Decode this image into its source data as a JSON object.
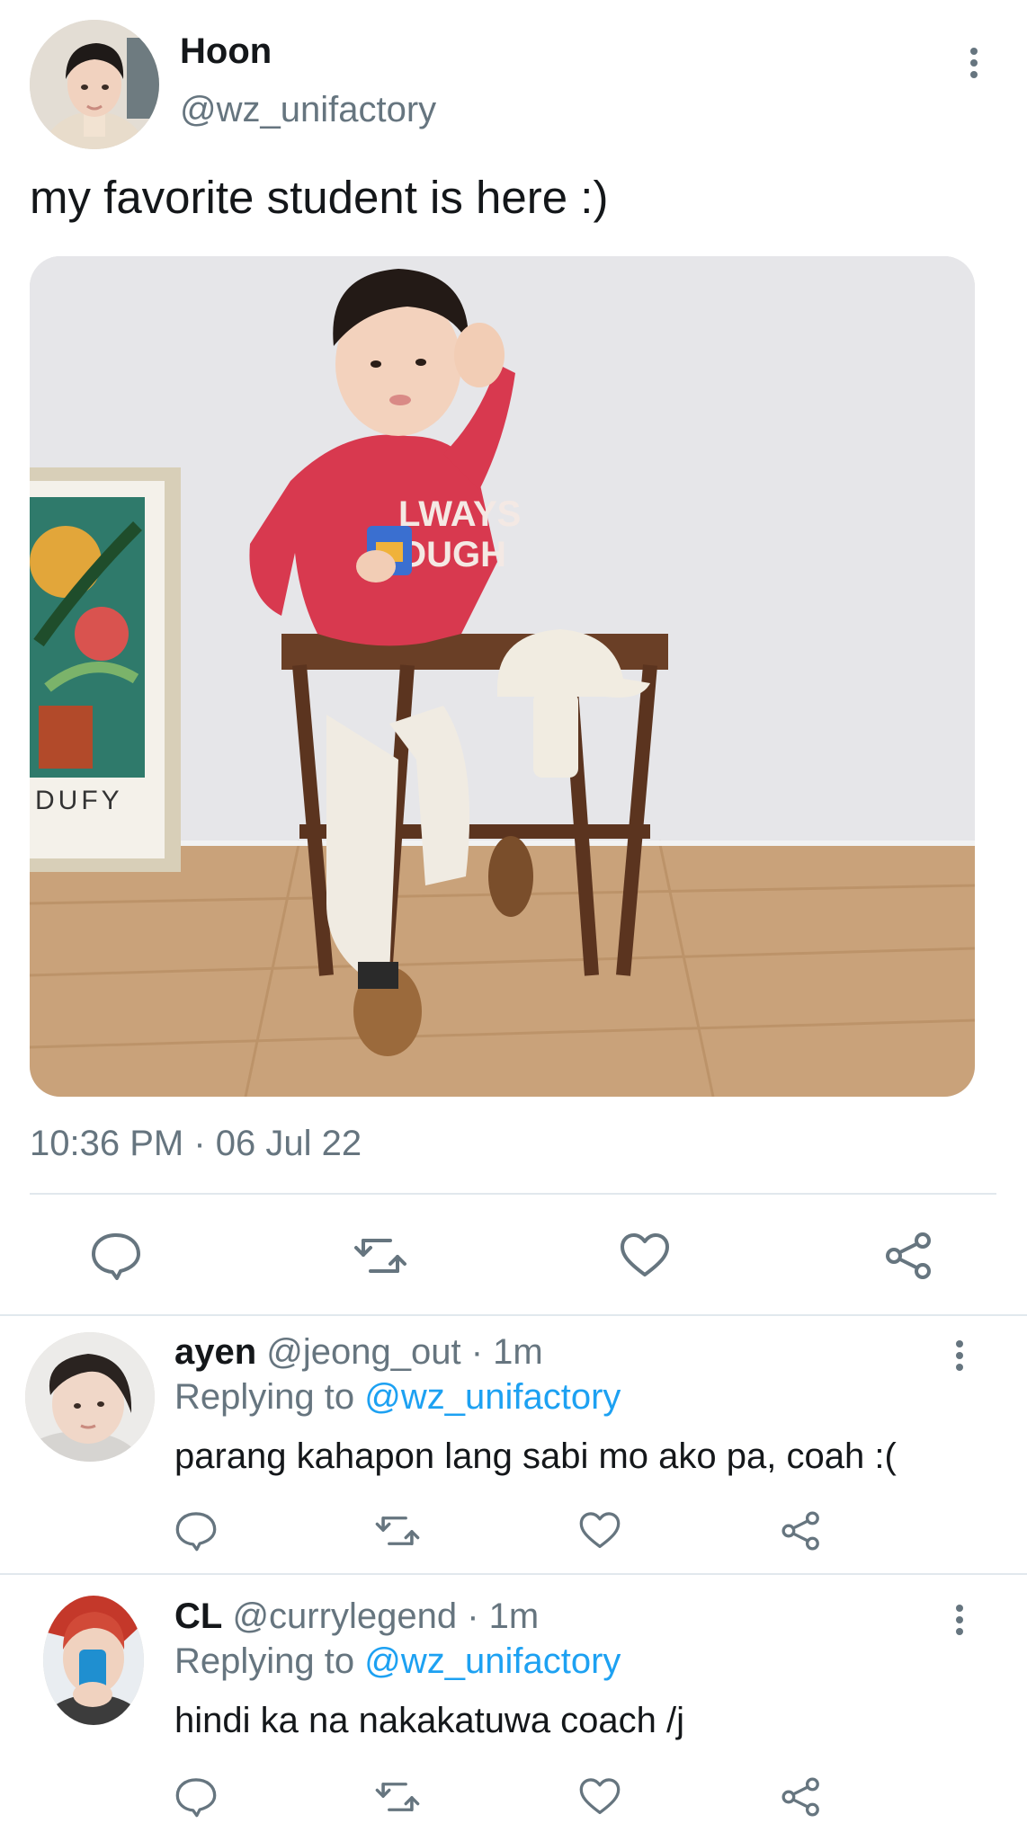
{
  "tweet": {
    "author_name": "Hoon",
    "author_handle": "@wz_unifactory",
    "text": "my favorite student is here :)",
    "timestamp": "10:36 PM · 06 Jul 22",
    "media_poster_text": "DUFY",
    "sweater_text_1": "LWAYS",
    "sweater_text_2": "OUGH"
  },
  "replies": [
    {
      "name": "ayen",
      "handle": "@jeong_out",
      "time": "· 1m",
      "replying_prefix": "Replying to",
      "replying_to": "@wz_unifactory",
      "text": "parang kahapon lang sabi mo ako pa, coah :("
    },
    {
      "name": "CL",
      "handle": "@currylegend",
      "time": "· 1m",
      "replying_prefix": "Replying to",
      "replying_to": "@wz_unifactory",
      "text": "hindi ka na nakakatuwa coach /j"
    }
  ],
  "icons": {
    "reply": "speech-bubble-icon",
    "retweet": "retweet-icon",
    "like": "heart-icon",
    "share": "share-icon",
    "more": "vertical-ellipsis-icon"
  },
  "colors": {
    "text": "#14171a",
    "secondary": "#66757f",
    "link": "#1da1f2",
    "divider": "#e1e8ed"
  }
}
